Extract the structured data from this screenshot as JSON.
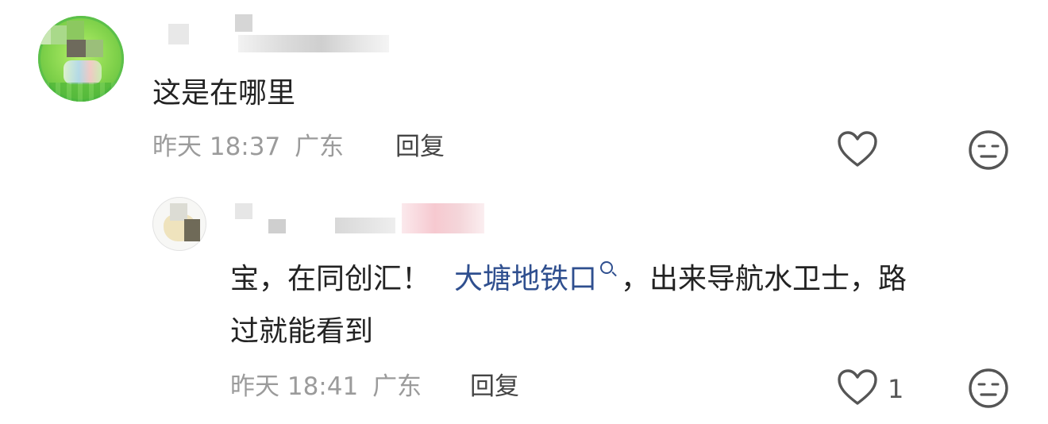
{
  "comments": [
    {
      "text": "这是在哪里",
      "time": "昨天 18:37",
      "location": "广东",
      "reply_label": "回复"
    }
  ],
  "reply": {
    "text_before": "宝，在同创汇！",
    "link_text": "大塘地铁口",
    "text_after_line1": "，出来导航水卫士，路",
    "text_line2": "过就能看到",
    "time": "昨天 18:41",
    "location": "广东",
    "reply_label": "回复",
    "like_count": "1"
  },
  "icons": {
    "like": "heart-outline-icon",
    "dislike": "neutral-face-icon",
    "link_search": "search-icon"
  },
  "colors": {
    "link": "#2f4f8f",
    "meta": "#9b9b9b",
    "text": "#222222"
  }
}
